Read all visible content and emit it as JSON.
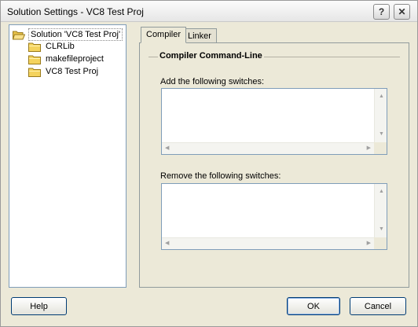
{
  "window": {
    "title": "Solution Settings - VC8 Test Proj",
    "help_glyph": "?",
    "close_glyph": "✕"
  },
  "tree": {
    "items": [
      {
        "label": "Solution 'VC8 Test Proj'",
        "icon": "open-folder-icon",
        "selected": true
      },
      {
        "label": "CLRLib",
        "icon": "folder-icon"
      },
      {
        "label": "makefileproject",
        "icon": "folder-icon"
      },
      {
        "label": "VC8 Test Proj",
        "icon": "folder-icon"
      }
    ]
  },
  "tabs": [
    {
      "label": "Compiler",
      "active": true
    },
    {
      "label": "Linker",
      "active": false
    }
  ],
  "group": {
    "title": "Compiler Command-Line"
  },
  "add_switches": {
    "label": "Add the following switches:",
    "value": ""
  },
  "remove_switches": {
    "label": "Remove the following switches:",
    "value": ""
  },
  "buttons": {
    "help": "Help",
    "ok": "OK",
    "cancel": "Cancel"
  },
  "colors": {
    "folder": "#f4d35e",
    "dialog_bg": "#ece9d8",
    "border": "#7f9db9"
  }
}
